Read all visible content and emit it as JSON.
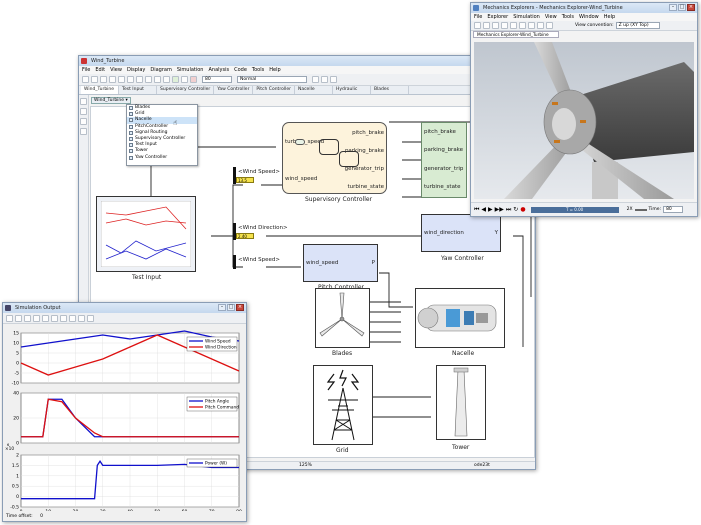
{
  "model_window": {
    "title": "Wind_Turbine",
    "menu": [
      "File",
      "Edit",
      "View",
      "Display",
      "Diagram",
      "Simulation",
      "Analysis",
      "Code",
      "Tools",
      "Help"
    ],
    "stop_time": "80",
    "mode": "Normal",
    "tabs": [
      "Wind_Turbine",
      "Test Input",
      "Supervisory Controller",
      "Yaw Controller",
      "Pitch Controller",
      "Nacelle",
      "Hydraulic",
      "Blades"
    ],
    "breadcrumb": "Wind_Turbine",
    "status_zoom": "125%",
    "status_solver": "ode23t",
    "dropdown_items": [
      "Blades",
      "Grid",
      "Nacelle",
      "PitchController",
      "Signal Routing",
      "Supervisory Controller",
      "Test Input",
      "Tower",
      "Yaw Controller"
    ],
    "dropdown_selected": 2
  },
  "diagram": {
    "supervisory": {
      "name": "Supervisory Controller",
      "inputs": [
        "turbine_speed",
        "wind_speed"
      ],
      "outputs": [
        "pitch_brake",
        "parking_brake",
        "generator_trip",
        "turbine_state"
      ]
    },
    "green_outputs": [
      "pitch_brake",
      "parking_brake",
      "generator_trip",
      "turbine_state"
    ],
    "goto_tags": [
      "<Wind Speed>",
      "<Wind Direction>",
      "<Wind Speed>"
    ],
    "displays": [
      "13.5",
      "2.40"
    ],
    "test_input": "Test Input",
    "yaw": {
      "name": "Yaw Controller",
      "in": "wind_direction",
      "out": "Y"
    },
    "pitch": {
      "name": "Pitch Controller",
      "in": "wind_speed",
      "out": "P"
    },
    "blades": "Blades",
    "nacelle": "Nacelle",
    "grid": "Grid",
    "tower": "Tower"
  },
  "explorer": {
    "title": "Mechanics Explorers - Mechanics Explorer-Wind_Turbine",
    "menu": [
      "File",
      "Explorer",
      "Simulation",
      "View",
      "Tools",
      "Window",
      "Help"
    ],
    "view_conv_label": "View convention:",
    "view_conv_value": "Z up (XY Top)",
    "tab": "Mechanics Explorer-Wind_Turbine",
    "time_display": "T = 0.00",
    "speed": "2X",
    "time_label": "Time:",
    "time_value": "80"
  },
  "sim_output": {
    "title": "Simulation Output",
    "time_offset_label": "Time offset:",
    "time_offset_value": "0",
    "exponent": "×10",
    "exponent_power": "6",
    "chart_data": [
      {
        "type": "line",
        "x": [
          0,
          10,
          20,
          30,
          40,
          50,
          60,
          70,
          80
        ],
        "series": [
          {
            "name": "Wind Speed",
            "color": "#1010cc",
            "values": [
              8,
              10,
              12,
              14,
              12,
              14,
              16,
              13,
              11
            ]
          },
          {
            "name": "Wind Direction",
            "color": "#dd1010",
            "values": [
              0,
              -6,
              -2,
              2,
              8,
              14,
              8,
              2,
              -4
            ]
          }
        ],
        "ylim": [
          -10,
          15
        ],
        "yticks": [
          "15",
          "10",
          "5",
          "0",
          "-5",
          "-10"
        ]
      },
      {
        "type": "line",
        "x": [
          0,
          8,
          10,
          15,
          20,
          27,
          30,
          40,
          80
        ],
        "series": [
          {
            "name": "Pitch Angle",
            "color": "#1010cc",
            "values": [
              0,
              0,
              30,
              30,
              15,
              0,
              0,
              0,
              0
            ]
          },
          {
            "name": "Pitch Command",
            "color": "#dd1010",
            "values": [
              0,
              0,
              30,
              28,
              15,
              3,
              0,
              0,
              0
            ]
          }
        ],
        "ylim": [
          -5,
          35
        ],
        "yticks": [
          "40",
          "20",
          "0"
        ]
      },
      {
        "type": "line",
        "x": [
          0,
          27,
          28,
          29,
          30,
          40,
          50,
          60,
          70,
          80
        ],
        "series": [
          {
            "name": "Power (W)",
            "color": "#1010cc",
            "values": [
              -0.1,
              -0.1,
              1.5,
              1.7,
              1.5,
              1.5,
              1.5,
              1.55,
              1.4,
              1.4
            ]
          }
        ],
        "ylim": [
          -0.5,
          2
        ],
        "yticks": [
          "2",
          "1.5",
          "1",
          "0.5",
          "0",
          "-0.5"
        ],
        "xticks": [
          "0",
          "10",
          "20",
          "30",
          "40",
          "50",
          "60",
          "70",
          "80"
        ]
      }
    ]
  },
  "colors": {
    "title_bar": "#c9dcf0",
    "superv_fill": "#fdf3dc",
    "green_fill": "#d8ebd2",
    "block_blue": "#dbe3f8",
    "display_yellow": "#f5e24c"
  }
}
